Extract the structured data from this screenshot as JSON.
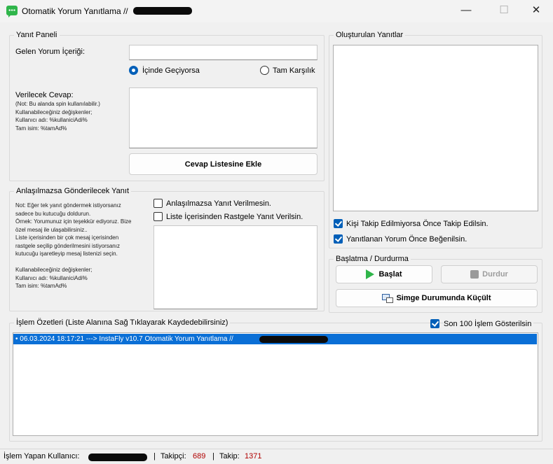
{
  "window": {
    "title": "Otomatik Yorum Yanıtlama //",
    "minimize": "—",
    "maximize": "☐",
    "close": "✕"
  },
  "reply_panel": {
    "title": "Yanıt Paneli",
    "incoming_label": "Gelen Yorum İçeriği:",
    "incoming_value": "",
    "match_contains": "İçinde Geçiyorsa",
    "match_exact": "Tam Karşılık",
    "match_selected": "contains",
    "answer_label": "Verilecek Cevap:",
    "answer_note": "(Not: Bu alanda spin kullanılabilir.)\nKullanabileceğiniz değişkenler;\nKullanıcı adı: %kullaniciAdi%\nTam isim: %tamAd%",
    "answer_value": "",
    "add_button": "Cevap Listesine Ekle"
  },
  "fallback_panel": {
    "title": "Anlaşılmazsa Gönderilecek Yanıt",
    "note": "Not: Eğer tek yanıt göndermek istiyorsanız\nsadece bu kutucuğu doldurun.\nÖrnek: Yorumunuz için teşekkür ediyoruz. Bize\nözel mesaj ile ulaşabilirsiniz..\nListe içerisinden bir çok mesaj içerisinden\nrastgele seçilip gönderilmesini istiyorsanız\nkutucuğu işaretleyip mesaj listenizi seçin.\n\nKullanabileceğiniz değişkenler;\nKullanıcı adı: %kullaniciAdi%\nTam isim: %tamAd%",
    "no_reply_label": "Anlaşılmazsa Yanıt Verilmesin.",
    "no_reply_checked": false,
    "random_label": "Liste İçerisinden Rastgele Yanıt Verilsin.",
    "random_checked": false,
    "message_value": ""
  },
  "created_replies": {
    "title": "Oluşturulan Yanıtlar",
    "follow_label": "Kişi Takip Edilmiyorsa Önce Takip Edilsin.",
    "follow_checked": true,
    "like_label": "Yanıtlanan Yorum Önce Beğenilsin.",
    "like_checked": true
  },
  "control": {
    "title": "Başlatma / Durdurma",
    "start": "Başlat",
    "stop": "Durdur",
    "minimize_tray": "Simge Durumunda Küçült"
  },
  "log": {
    "title": "İşlem Özetleri (Liste Alanına Sağ Tıklayarak Kaydedebilirsiniz)",
    "last100_label": "Son 100 İşlem Gösterilsin",
    "last100_checked": true,
    "entries": [
      "• 06.03.2024 18:17:21 ---> InstaFly v10.7 Otomatik Yorum Yanıtlama //"
    ]
  },
  "status": {
    "user_label": "İşlem Yapan Kullanıcı:",
    "followers_label": "Takipçi:",
    "followers": "689",
    "following_label": "Takip:",
    "following": "1371",
    "separator": "|"
  },
  "colors": {
    "accent": "#005fb8",
    "selection": "#0a6fd6",
    "stat_value": "#b00000",
    "start_icon": "#2fb54a"
  },
  "icons": {
    "app": "chat-bubble-icon",
    "start": "play-icon",
    "stop": "stop-icon",
    "tray": "minimize-to-tray-icon"
  }
}
